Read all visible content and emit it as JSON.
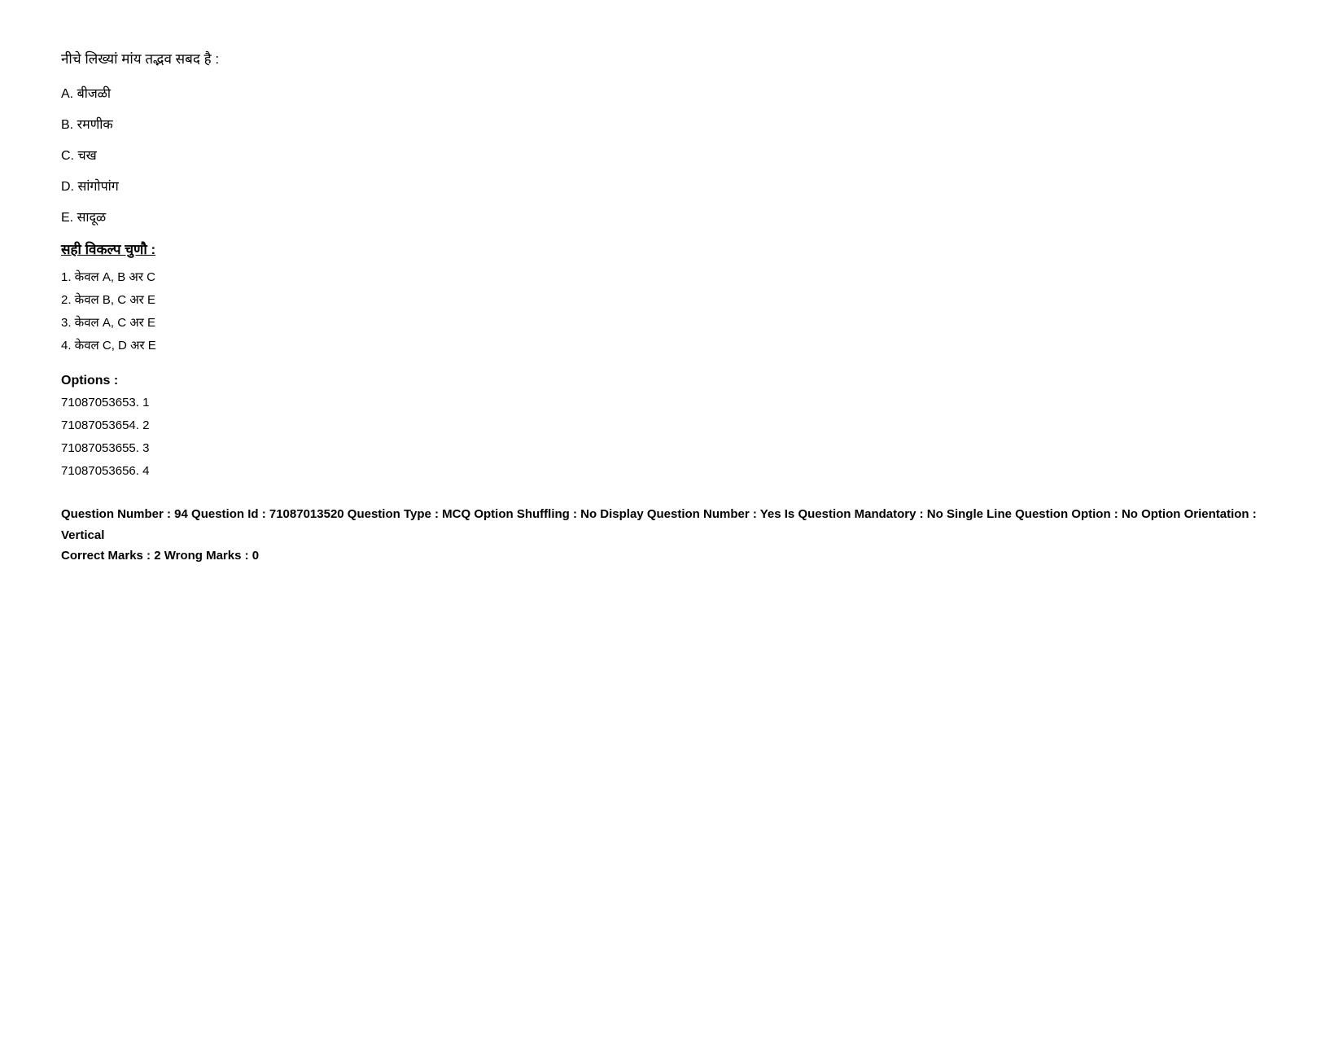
{
  "question": {
    "text": "नीचे लिख्यां मांय तद्भव सबद है :",
    "options": [
      {
        "label": "A.",
        "text": "बीजळी"
      },
      {
        "label": "B.",
        "text": "रमणीक"
      },
      {
        "label": "C.",
        "text": "चख"
      },
      {
        "label": "D.",
        "text": "सांगोपांग"
      },
      {
        "label": "E.",
        "text": "सादूळ"
      }
    ],
    "select_label": "सही विकल्प चुणौ :",
    "numbered_options": [
      "1. केवल A, B अर C",
      "2. केवल B, C अर E",
      "3. केवल A, C अर E",
      "4. केवल C, D अर E"
    ],
    "options_header": "Options :",
    "option_codes": [
      "71087053653. 1",
      "71087053654. 2",
      "71087053655. 3",
      "71087053656. 4"
    ],
    "meta": {
      "line1": "Question Number : 94 Question Id : 71087013520 Question Type : MCQ Option Shuffling : No Display Question Number : Yes Is Question Mandatory : No Single Line Question Option : No Option Orientation : Vertical",
      "line2": "Correct Marks : 2 Wrong Marks : 0"
    }
  }
}
